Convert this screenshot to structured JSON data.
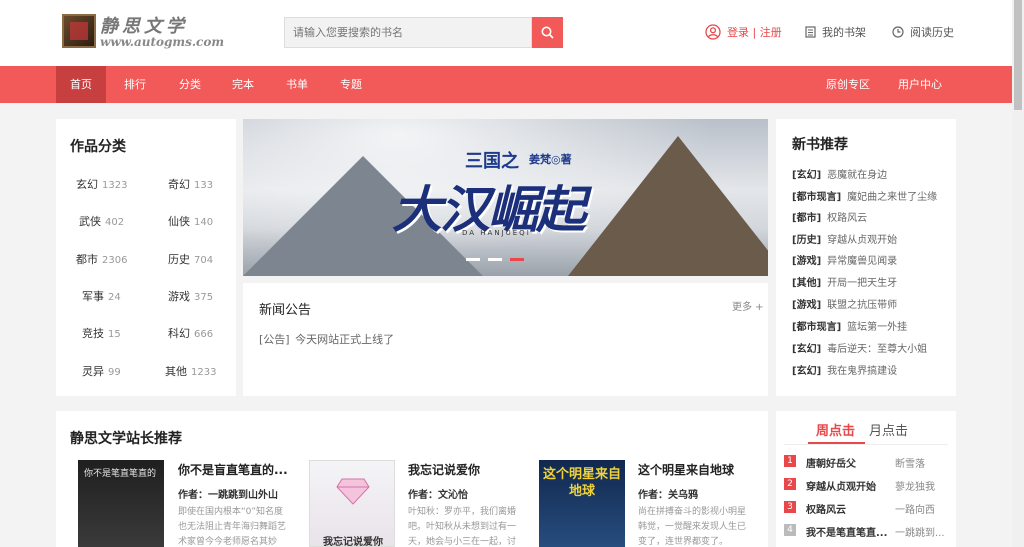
{
  "header": {
    "logo_text": "静思文学",
    "logo_url": "www.autogms.com",
    "search_placeholder": "请输入您要搜索的书名",
    "login_label": "登录 | 注册",
    "bookshelf_label": "我的书架",
    "history_label": "阅读历史"
  },
  "nav": {
    "items": [
      "首页",
      "排行",
      "分类",
      "完本",
      "书单",
      "专题"
    ],
    "right_items": [
      "原创专区",
      "用户中心"
    ]
  },
  "categories": {
    "title": "作品分类",
    "items": [
      {
        "name": "玄幻",
        "count": "1323"
      },
      {
        "name": "奇幻",
        "count": "133"
      },
      {
        "name": "武侠",
        "count": "402"
      },
      {
        "name": "仙侠",
        "count": "140"
      },
      {
        "name": "都市",
        "count": "2306"
      },
      {
        "name": "历史",
        "count": "704"
      },
      {
        "name": "军事",
        "count": "24"
      },
      {
        "name": "游戏",
        "count": "375"
      },
      {
        "name": "竞技",
        "count": "15"
      },
      {
        "name": "科幻",
        "count": "666"
      },
      {
        "name": "灵异",
        "count": "99"
      },
      {
        "name": "其他",
        "count": "1233"
      }
    ]
  },
  "banner": {
    "title_prefix": "三国之",
    "author": "姜梵◎著",
    "title": "大汉崛起",
    "subtitle": "DA HANJUEQI"
  },
  "news": {
    "title": "新闻公告",
    "more": "更多 +",
    "items": [
      {
        "tag": "[公告]",
        "text": "今天网站正式上线了"
      }
    ]
  },
  "new_books": {
    "title": "新书推荐",
    "items": [
      {
        "tag": "[玄幻]",
        "name": "恶魔就在身边"
      },
      {
        "tag": "[都市现言]",
        "name": "魔妃曲之来世了尘缘"
      },
      {
        "tag": "[都市]",
        "name": "权路风云"
      },
      {
        "tag": "[历史]",
        "name": "穿越从贞观开始"
      },
      {
        "tag": "[游戏]",
        "name": "异常魔兽见闻录"
      },
      {
        "tag": "[其他]",
        "name": "开局一把天生牙"
      },
      {
        "tag": "[游戏]",
        "name": "联盟之抗压带师"
      },
      {
        "tag": "[都市现言]",
        "name": "篮坛第一外挂"
      },
      {
        "tag": "[玄幻]",
        "name": "毒后逆天：至尊大小姐"
      },
      {
        "tag": "[玄幻]",
        "name": "我在鬼界搞建设"
      }
    ]
  },
  "recommend": {
    "title": "静思文学站长推荐",
    "books": [
      {
        "title": "你不是盲直笔直的...",
        "author": "作者：一跳跳到山外山",
        "desc": "即使在国内根本“0”知名度也无法阻止青年海归舞蹈艺术家曾今今老师愿名其妙",
        "cover_text": "你不是笔直笔直的"
      },
      {
        "title": "我忘记说爱你",
        "author": "作者：文沁怡",
        "desc": "叶知秋：罗亦平，我们离婚吧。叶知秋从未想到过有一天，她会与小三在一起，讨",
        "cover_text": "我忘记说爱你"
      },
      {
        "title": "这个明星来自地球",
        "author": "作者：关乌鸦",
        "desc": "尚在拼搏奋斗的影视小明星韩觉，一觉醒来发现人生已变了，连世界都变了。",
        "cover_text": "这个明星来自地球"
      }
    ]
  },
  "ranking": {
    "tab_week": "周点击",
    "tab_month": "月点击",
    "items": [
      {
        "rank": "1",
        "name": "唐朝好岳父",
        "author": "断雪落"
      },
      {
        "rank": "2",
        "name": "穿越从贞观开始",
        "author": "蓼龙独我"
      },
      {
        "rank": "3",
        "name": "权路风云",
        "author": "一路向西"
      },
      {
        "rank": "4",
        "name": "我不是笔直笔直...",
        "author": "一跳跳到..."
      }
    ]
  },
  "colors": {
    "brand": "#f25a5a",
    "nav_active": "#c83f3f",
    "accent_text": "#e8484a"
  }
}
